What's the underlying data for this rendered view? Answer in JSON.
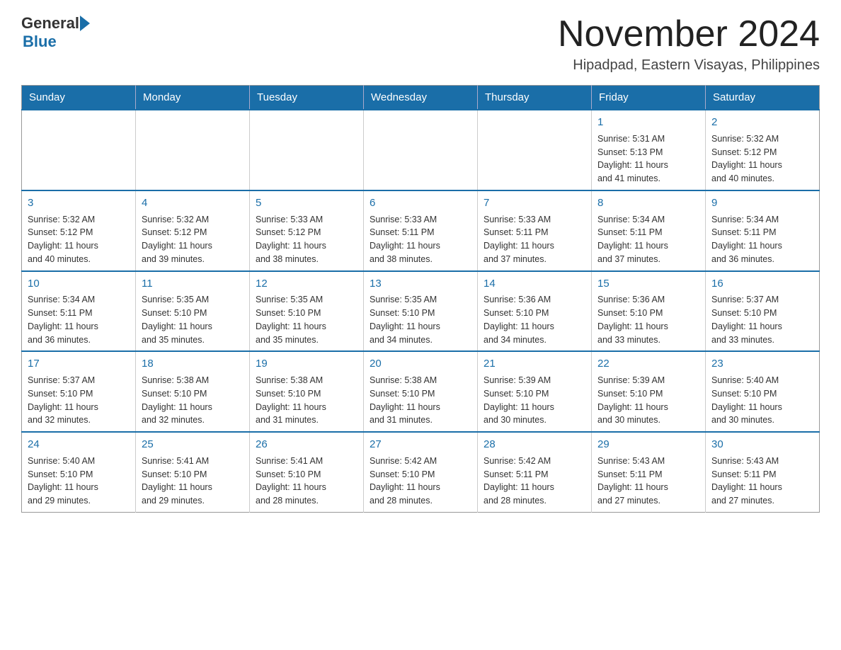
{
  "header": {
    "logo_general": "General",
    "logo_blue": "Blue",
    "month_title": "November 2024",
    "location": "Hipadpad, Eastern Visayas, Philippines"
  },
  "calendar": {
    "days_of_week": [
      "Sunday",
      "Monday",
      "Tuesday",
      "Wednesday",
      "Thursday",
      "Friday",
      "Saturday"
    ],
    "weeks": [
      [
        {
          "day": "",
          "info": ""
        },
        {
          "day": "",
          "info": ""
        },
        {
          "day": "",
          "info": ""
        },
        {
          "day": "",
          "info": ""
        },
        {
          "day": "",
          "info": ""
        },
        {
          "day": "1",
          "info": "Sunrise: 5:31 AM\nSunset: 5:13 PM\nDaylight: 11 hours\nand 41 minutes."
        },
        {
          "day": "2",
          "info": "Sunrise: 5:32 AM\nSunset: 5:12 PM\nDaylight: 11 hours\nand 40 minutes."
        }
      ],
      [
        {
          "day": "3",
          "info": "Sunrise: 5:32 AM\nSunset: 5:12 PM\nDaylight: 11 hours\nand 40 minutes."
        },
        {
          "day": "4",
          "info": "Sunrise: 5:32 AM\nSunset: 5:12 PM\nDaylight: 11 hours\nand 39 minutes."
        },
        {
          "day": "5",
          "info": "Sunrise: 5:33 AM\nSunset: 5:12 PM\nDaylight: 11 hours\nand 38 minutes."
        },
        {
          "day": "6",
          "info": "Sunrise: 5:33 AM\nSunset: 5:11 PM\nDaylight: 11 hours\nand 38 minutes."
        },
        {
          "day": "7",
          "info": "Sunrise: 5:33 AM\nSunset: 5:11 PM\nDaylight: 11 hours\nand 37 minutes."
        },
        {
          "day": "8",
          "info": "Sunrise: 5:34 AM\nSunset: 5:11 PM\nDaylight: 11 hours\nand 37 minutes."
        },
        {
          "day": "9",
          "info": "Sunrise: 5:34 AM\nSunset: 5:11 PM\nDaylight: 11 hours\nand 36 minutes."
        }
      ],
      [
        {
          "day": "10",
          "info": "Sunrise: 5:34 AM\nSunset: 5:11 PM\nDaylight: 11 hours\nand 36 minutes."
        },
        {
          "day": "11",
          "info": "Sunrise: 5:35 AM\nSunset: 5:10 PM\nDaylight: 11 hours\nand 35 minutes."
        },
        {
          "day": "12",
          "info": "Sunrise: 5:35 AM\nSunset: 5:10 PM\nDaylight: 11 hours\nand 35 minutes."
        },
        {
          "day": "13",
          "info": "Sunrise: 5:35 AM\nSunset: 5:10 PM\nDaylight: 11 hours\nand 34 minutes."
        },
        {
          "day": "14",
          "info": "Sunrise: 5:36 AM\nSunset: 5:10 PM\nDaylight: 11 hours\nand 34 minutes."
        },
        {
          "day": "15",
          "info": "Sunrise: 5:36 AM\nSunset: 5:10 PM\nDaylight: 11 hours\nand 33 minutes."
        },
        {
          "day": "16",
          "info": "Sunrise: 5:37 AM\nSunset: 5:10 PM\nDaylight: 11 hours\nand 33 minutes."
        }
      ],
      [
        {
          "day": "17",
          "info": "Sunrise: 5:37 AM\nSunset: 5:10 PM\nDaylight: 11 hours\nand 32 minutes."
        },
        {
          "day": "18",
          "info": "Sunrise: 5:38 AM\nSunset: 5:10 PM\nDaylight: 11 hours\nand 32 minutes."
        },
        {
          "day": "19",
          "info": "Sunrise: 5:38 AM\nSunset: 5:10 PM\nDaylight: 11 hours\nand 31 minutes."
        },
        {
          "day": "20",
          "info": "Sunrise: 5:38 AM\nSunset: 5:10 PM\nDaylight: 11 hours\nand 31 minutes."
        },
        {
          "day": "21",
          "info": "Sunrise: 5:39 AM\nSunset: 5:10 PM\nDaylight: 11 hours\nand 30 minutes."
        },
        {
          "day": "22",
          "info": "Sunrise: 5:39 AM\nSunset: 5:10 PM\nDaylight: 11 hours\nand 30 minutes."
        },
        {
          "day": "23",
          "info": "Sunrise: 5:40 AM\nSunset: 5:10 PM\nDaylight: 11 hours\nand 30 minutes."
        }
      ],
      [
        {
          "day": "24",
          "info": "Sunrise: 5:40 AM\nSunset: 5:10 PM\nDaylight: 11 hours\nand 29 minutes."
        },
        {
          "day": "25",
          "info": "Sunrise: 5:41 AM\nSunset: 5:10 PM\nDaylight: 11 hours\nand 29 minutes."
        },
        {
          "day": "26",
          "info": "Sunrise: 5:41 AM\nSunset: 5:10 PM\nDaylight: 11 hours\nand 28 minutes."
        },
        {
          "day": "27",
          "info": "Sunrise: 5:42 AM\nSunset: 5:10 PM\nDaylight: 11 hours\nand 28 minutes."
        },
        {
          "day": "28",
          "info": "Sunrise: 5:42 AM\nSunset: 5:11 PM\nDaylight: 11 hours\nand 28 minutes."
        },
        {
          "day": "29",
          "info": "Sunrise: 5:43 AM\nSunset: 5:11 PM\nDaylight: 11 hours\nand 27 minutes."
        },
        {
          "day": "30",
          "info": "Sunrise: 5:43 AM\nSunset: 5:11 PM\nDaylight: 11 hours\nand 27 minutes."
        }
      ]
    ]
  }
}
